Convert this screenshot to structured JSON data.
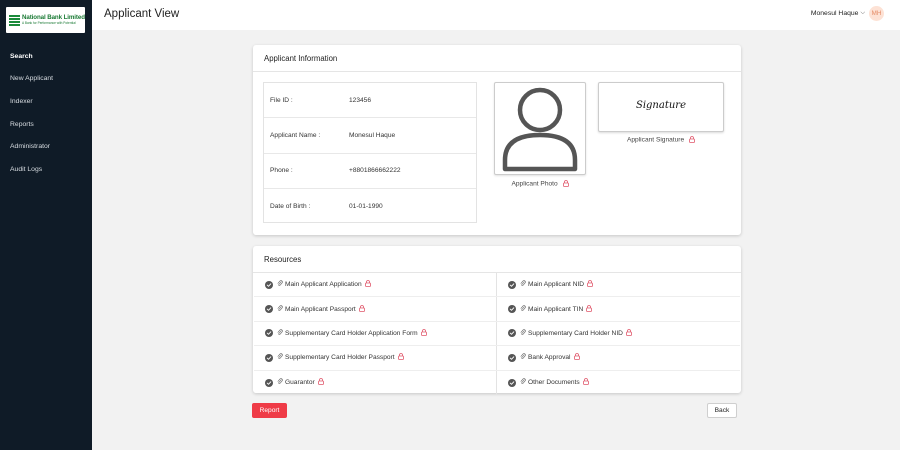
{
  "brand": {
    "name": "National Bank Limited",
    "tagline": "A Bank for Performance with Potential",
    "logo_color": "#1a8a3a"
  },
  "sidebar": {
    "items": [
      {
        "label": "Search",
        "active": true
      },
      {
        "label": "New Applicant"
      },
      {
        "label": "Indexer"
      },
      {
        "label": "Reports"
      },
      {
        "label": "Administrator"
      },
      {
        "label": "Audit Logs"
      }
    ]
  },
  "header": {
    "title": "Applicant View",
    "user_name": "Monesul Haque",
    "chevron": "⌵",
    "avatar_initials": "MH"
  },
  "applicant_info": {
    "heading": "Applicant Information",
    "fields": [
      {
        "label": "File ID",
        "sep": ":",
        "value": "123456"
      },
      {
        "label": "Applicant Name",
        "sep": ":",
        "value": "Monesul Haque"
      },
      {
        "label": "Phone",
        "sep": ":",
        "value": "+8801866662222"
      },
      {
        "label": "Date of Birth",
        "sep": ":",
        "value": "01-01-1990"
      }
    ],
    "photo_label": "Applicant Photo",
    "signature_text": "Signature",
    "signature_label": "Applicant Signature"
  },
  "resources": {
    "heading": "Resources",
    "items": [
      [
        "Main Applicant Application",
        "Main Applicant NID"
      ],
      [
        "Main Applicant Passport",
        "Main Applicant TIN"
      ],
      [
        "Supplementary Card Holder Application Form",
        "Supplementary Card Holder NID"
      ],
      [
        "Supplementary Card Holder Passport",
        "Bank Approval"
      ],
      [
        "Guarantor",
        "Other Documents"
      ]
    ]
  },
  "actions": {
    "report_label": "Report",
    "back_label": "Back"
  },
  "colors": {
    "sidebar_bg": "#0f1b27",
    "lock_icon": "#e0566a",
    "report_button": "#ef3b47",
    "avatar_bg": "#fde2d5"
  }
}
